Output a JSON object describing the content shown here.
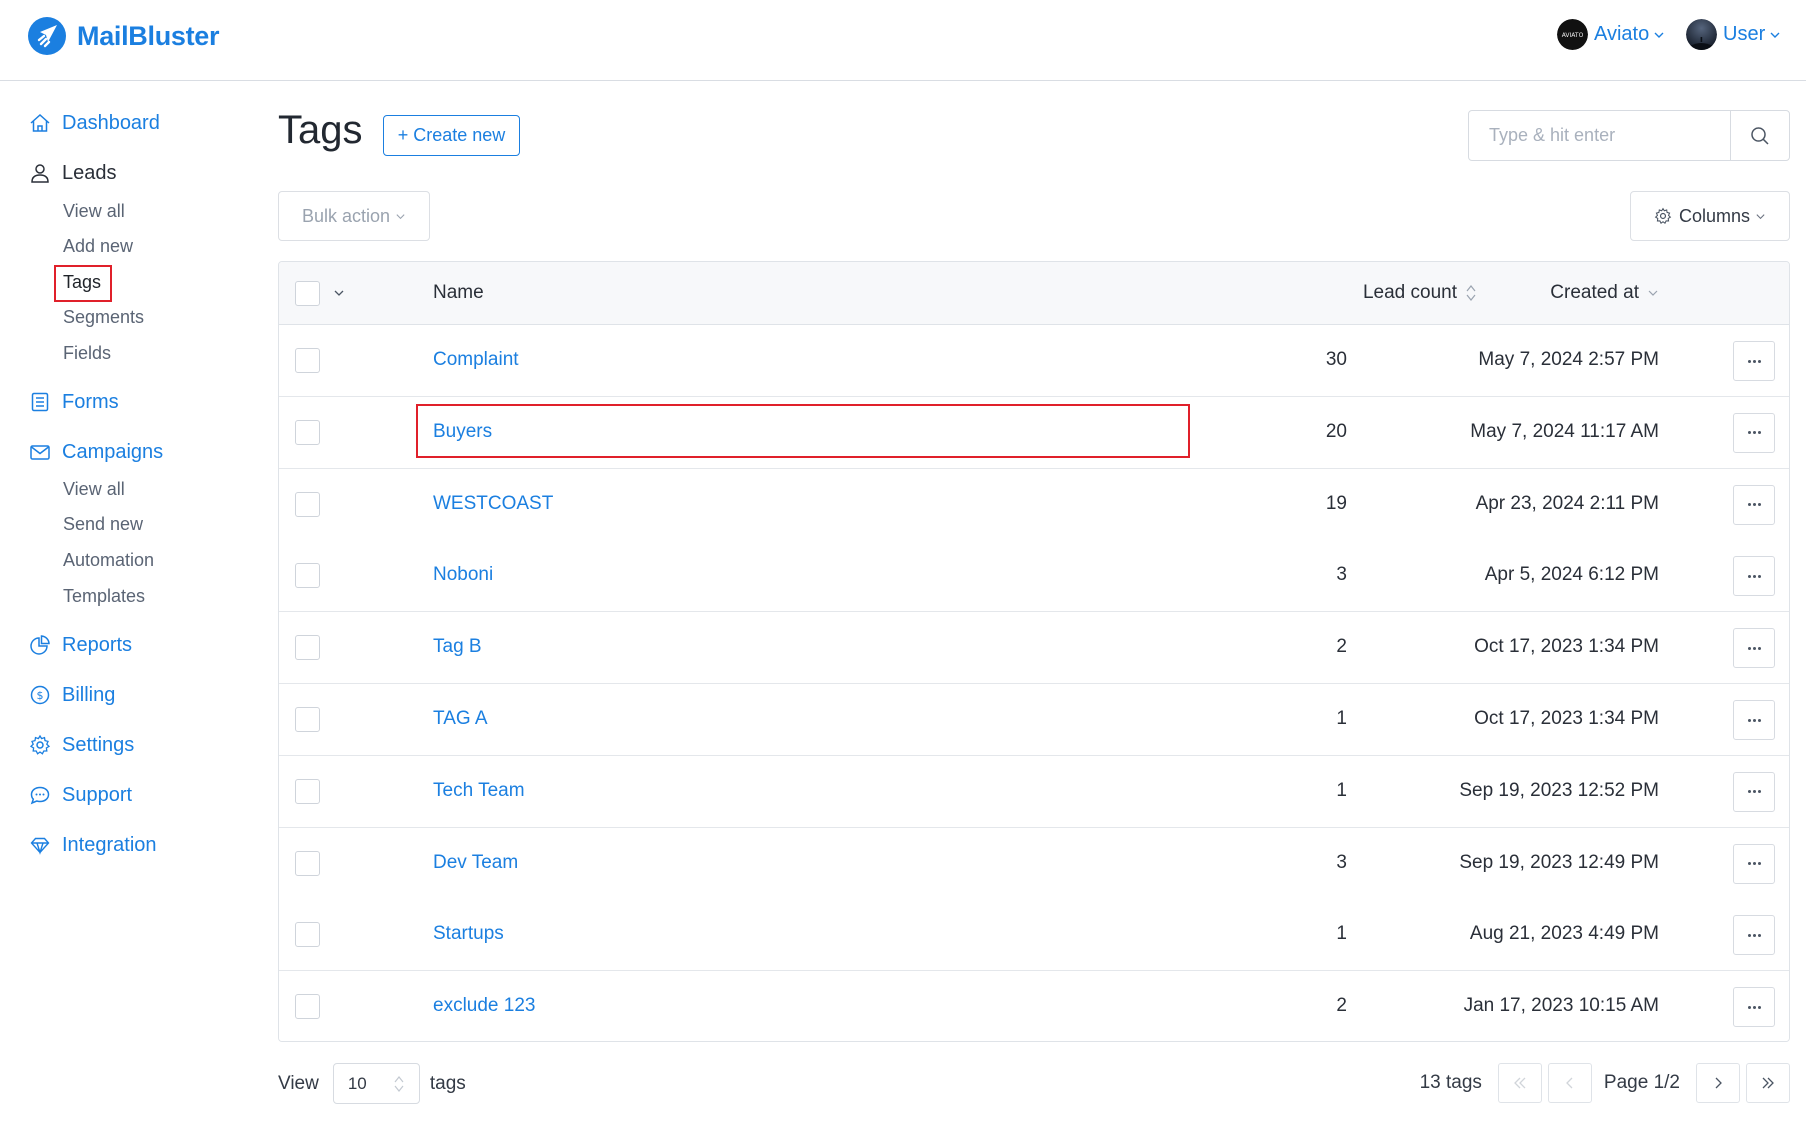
{
  "brand": {
    "name": "MailBluster",
    "color": "#1b7fe0"
  },
  "topbar": {
    "organization": {
      "name": "Aviato",
      "avatar_text": "AVIATO"
    },
    "user": {
      "name": "User"
    }
  },
  "sidebar": {
    "items": [
      {
        "label": "Dashboard",
        "icon": "home-icon"
      },
      {
        "label": "Leads",
        "icon": "user-icon",
        "children": [
          "View all",
          "Add new",
          "Tags",
          "Segments",
          "Fields"
        ],
        "active_child": "Tags"
      },
      {
        "label": "Forms",
        "icon": "form-list-icon"
      },
      {
        "label": "Campaigns",
        "icon": "envelope-icon",
        "children": [
          "View all",
          "Send new",
          "Automation",
          "Templates"
        ]
      },
      {
        "label": "Reports",
        "icon": "pie-chart-icon"
      },
      {
        "label": "Billing",
        "icon": "dollar-circle-icon"
      },
      {
        "label": "Settings",
        "icon": "gear-icon"
      },
      {
        "label": "Support",
        "icon": "chat-bubble-icon"
      },
      {
        "label": "Integration",
        "icon": "diamond-icon"
      }
    ]
  },
  "page": {
    "title": "Tags",
    "create_label": "+ Create new",
    "search_placeholder": "Type & hit enter",
    "bulk_action_label": "Bulk action",
    "columns_label": "Columns"
  },
  "table": {
    "columns": {
      "name": "Name",
      "lead_count": "Lead count",
      "created_at": "Created at"
    },
    "rows": [
      {
        "name": "Complaint",
        "lead_count": "30",
        "created_at": "May 7, 2024 2:57 PM"
      },
      {
        "name": "Buyers",
        "lead_count": "20",
        "created_at": "May 7, 2024 11:17 AM"
      },
      {
        "name": "WESTCOAST",
        "lead_count": "19",
        "created_at": "Apr 23, 2024 2:11 PM"
      },
      {
        "name": "Noboni",
        "lead_count": "3",
        "created_at": "Apr 5, 2024 6:12 PM"
      },
      {
        "name": "Tag B",
        "lead_count": "2",
        "created_at": "Oct 17, 2023 1:34 PM"
      },
      {
        "name": "TAG A",
        "lead_count": "1",
        "created_at": "Oct 17, 2023 1:34 PM"
      },
      {
        "name": "Tech Team",
        "lead_count": "1",
        "created_at": "Sep 19, 2023 12:52 PM"
      },
      {
        "name": "Dev Team",
        "lead_count": "3",
        "created_at": "Sep 19, 2023 12:49 PM"
      },
      {
        "name": "Startups",
        "lead_count": "1",
        "created_at": "Aug 21, 2023 4:49 PM"
      },
      {
        "name": "exclude 123",
        "lead_count": "2",
        "created_at": "Jan 17, 2023 10:15 AM"
      }
    ]
  },
  "footer": {
    "view_label": "View",
    "per_page": "10",
    "per_page_suffix": "tags",
    "total": "13 tags",
    "page_label": "Page 1/2"
  },
  "annotations": {
    "highlight_color": "#e0202a"
  }
}
